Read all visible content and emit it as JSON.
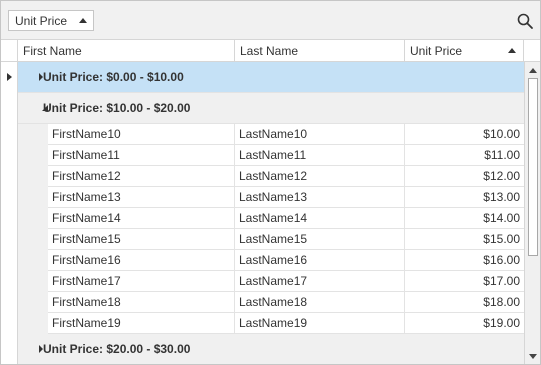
{
  "group_panel": {
    "chip_label": "Unit Price"
  },
  "header": {
    "first_name": "First Name",
    "last_name": "Last Name",
    "unit_price": "Unit Price"
  },
  "groups": [
    {
      "label": "Unit Price: $0.00 - $10.00",
      "expanded": false,
      "selected": true
    },
    {
      "label": "Unit Price: $10.00 - $20.00",
      "expanded": true,
      "selected": false
    },
    {
      "label": "Unit Price: $20.00 - $30.00",
      "expanded": false,
      "selected": false
    }
  ],
  "rows": [
    {
      "first": "FirstName10",
      "last": "LastName10",
      "price": "$10.00"
    },
    {
      "first": "FirstName11",
      "last": "LastName11",
      "price": "$11.00"
    },
    {
      "first": "FirstName12",
      "last": "LastName12",
      "price": "$12.00"
    },
    {
      "first": "FirstName13",
      "last": "LastName13",
      "price": "$13.00"
    },
    {
      "first": "FirstName14",
      "last": "LastName14",
      "price": "$14.00"
    },
    {
      "first": "FirstName15",
      "last": "LastName15",
      "price": "$15.00"
    },
    {
      "first": "FirstName16",
      "last": "LastName16",
      "price": "$16.00"
    },
    {
      "first": "FirstName17",
      "last": "LastName17",
      "price": "$17.00"
    },
    {
      "first": "FirstName18",
      "last": "LastName18",
      "price": "$18.00"
    },
    {
      "first": "FirstName19",
      "last": "LastName19",
      "price": "$19.00"
    }
  ],
  "icons": {
    "search": "search-icon",
    "sort": "sort-ascending-icon",
    "collapsed": "caret-right-icon",
    "expanded": "caret-down-icon",
    "current_row": "current-row-indicator-icon",
    "scroll_up": "scroll-up-icon",
    "scroll_down": "scroll-down-icon"
  },
  "colors": {
    "selected_group": "#c5e1f6",
    "group_background": "#f0f0f0",
    "border": "#d6d6d6"
  }
}
